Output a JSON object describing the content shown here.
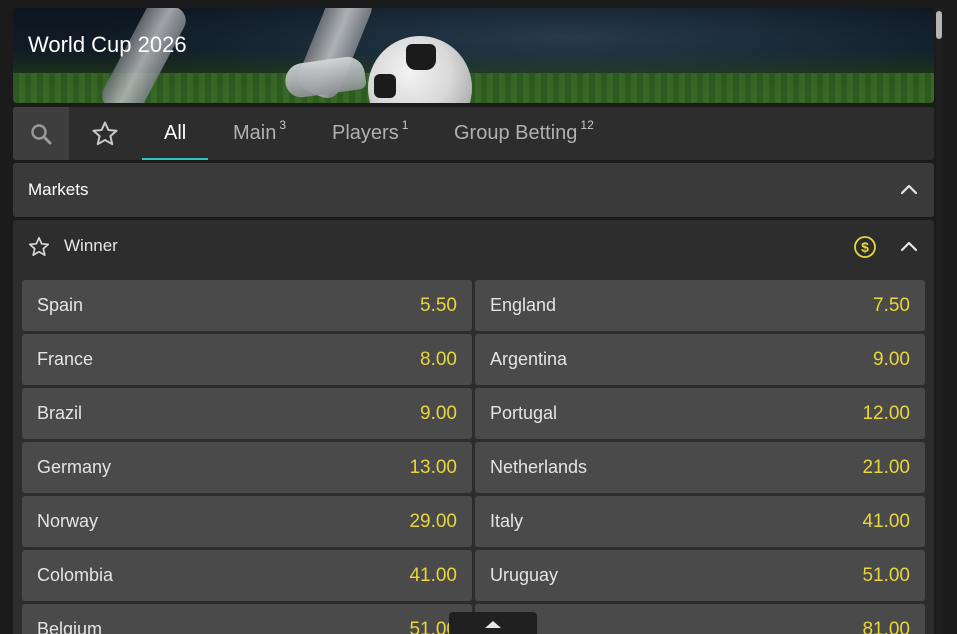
{
  "banner": {
    "title": "World Cup 2026"
  },
  "tabs": [
    {
      "label": "All",
      "count": ""
    },
    {
      "label": "Main",
      "count": "3"
    },
    {
      "label": "Players",
      "count": "1"
    },
    {
      "label": "Group Betting",
      "count": "12"
    }
  ],
  "icons": {
    "search": "search-icon",
    "favorite": "star-icon",
    "collapse": "chevron-up-icon",
    "cashout": "dollar-circle-icon",
    "scroll_top": "caret-up-icon"
  },
  "markets": {
    "label": "Markets"
  },
  "winner": {
    "label": "Winner",
    "selections": [
      {
        "team": "Spain",
        "price": "5.50"
      },
      {
        "team": "England",
        "price": "7.50"
      },
      {
        "team": "France",
        "price": "8.00"
      },
      {
        "team": "Argentina",
        "price": "9.00"
      },
      {
        "team": "Brazil",
        "price": "9.00"
      },
      {
        "team": "Portugal",
        "price": "12.00"
      },
      {
        "team": "Germany",
        "price": "13.00"
      },
      {
        "team": "Netherlands",
        "price": "21.00"
      },
      {
        "team": "Norway",
        "price": "29.00"
      },
      {
        "team": "Italy",
        "price": "41.00"
      },
      {
        "team": "Colombia",
        "price": "41.00"
      },
      {
        "team": "Uruguay",
        "price": "51.00"
      },
      {
        "team": "Belgium",
        "price": "51.00"
      },
      {
        "team": "",
        "price": "81.00"
      }
    ]
  },
  "colors": {
    "accent": "#2fc6c6",
    "odds": "#e8d63a",
    "cashout": "#e8d63a"
  }
}
